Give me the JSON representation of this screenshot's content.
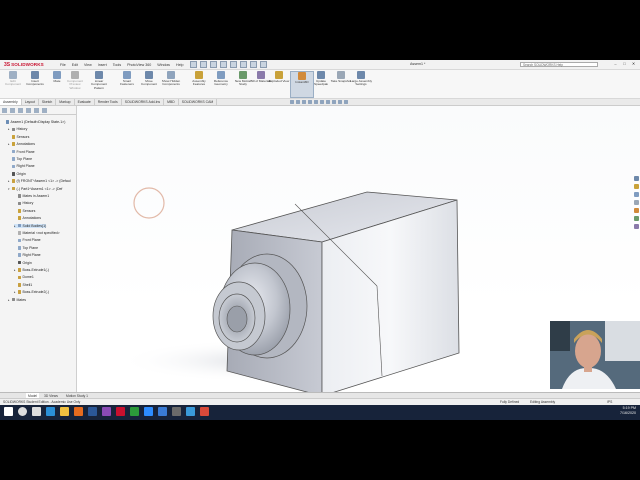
{
  "app": {
    "logo_ds": "3S",
    "logo_name": "SOLIDWORKS",
    "menus": [
      "File",
      "Edit",
      "View",
      "Insert",
      "Tools",
      "PhotoView 360",
      "Window",
      "Help"
    ],
    "document_title": "Assem1 *",
    "search_placeholder": "Search SOLIDWORKS Help"
  },
  "ribbon": {
    "buttons": [
      {
        "label": "Edit Component",
        "dim": true
      },
      {
        "label": "Insert Components"
      },
      {
        "label": "Mate"
      },
      {
        "label": "Component Preview Window",
        "dim": true
      },
      {
        "label": "Linear Component Pattern"
      },
      {
        "label": "Smart Fasteners"
      },
      {
        "label": "Move Component"
      },
      {
        "label": "Show Hidden Components"
      },
      {
        "label": "Assembly Features"
      },
      {
        "label": "Reference Geometry"
      },
      {
        "label": "New Motion Study"
      },
      {
        "label": "Bill of Materials"
      },
      {
        "label": "Exploded View"
      },
      {
        "label": "Instant3D",
        "active": true
      },
      {
        "label": "Update Speedpak"
      },
      {
        "label": "Take Snapshot"
      },
      {
        "label": "Large Assembly Settings"
      }
    ]
  },
  "tabs": [
    "Assembly",
    "Layout",
    "Sketch",
    "Markup",
    "Evaluate",
    "Render Tools",
    "SOLIDWORKS Add-Ins",
    "MBD",
    "SOLIDWORKS CAM"
  ],
  "tree": {
    "nodes": [
      {
        "label": "Assem1  (Default<Display State-1>)",
        "depth": 0,
        "exp": "",
        "color": "#6b8db5"
      },
      {
        "label": "History",
        "depth": 1,
        "exp": "▸",
        "color": "#8a8a8a"
      },
      {
        "label": "Sensors",
        "depth": 1,
        "exp": "",
        "color": "#c9a23a"
      },
      {
        "label": "Annotations",
        "depth": 1,
        "exp": "▸",
        "color": "#c9a23a"
      },
      {
        "label": "Front Plane",
        "depth": 1,
        "exp": "",
        "color": "#8fa8c8"
      },
      {
        "label": "Top Plane",
        "depth": 1,
        "exp": "",
        "color": "#8fa8c8"
      },
      {
        "label": "Right Plane",
        "depth": 1,
        "exp": "",
        "color": "#8fa8c8"
      },
      {
        "label": "Origin",
        "depth": 1,
        "exp": "",
        "color": "#555555"
      },
      {
        "label": "(f) FRONT^Assem1 <1> -> (Defaul",
        "depth": 1,
        "exp": "▸",
        "color": "#c8a040"
      },
      {
        "label": "(-) Part1^Assem1 <1> -> (Def",
        "depth": 1,
        "exp": "▾",
        "color": "#c8a040"
      },
      {
        "label": "Mates in Assem1",
        "depth": 2,
        "exp": "",
        "color": "#8a8a8a"
      },
      {
        "label": "History",
        "depth": 2,
        "exp": "",
        "color": "#8a8a8a"
      },
      {
        "label": "Sensors",
        "depth": 2,
        "exp": "",
        "color": "#c9a23a"
      },
      {
        "label": "Annotations",
        "depth": 2,
        "exp": "",
        "color": "#c9a23a"
      },
      {
        "label": "Solid Bodies(1)",
        "depth": 2,
        "exp": "▸",
        "color": "#7f9cc0",
        "sel": true
      },
      {
        "label": "Material <not specified>",
        "depth": 2,
        "exp": "",
        "color": "#b0b0b0"
      },
      {
        "label": "Front Plane",
        "depth": 2,
        "exp": "",
        "color": "#8fa8c8"
      },
      {
        "label": "Top Plane",
        "depth": 2,
        "exp": "",
        "color": "#8fa8c8"
      },
      {
        "label": "Right Plane",
        "depth": 2,
        "exp": "",
        "color": "#8fa8c8"
      },
      {
        "label": "Origin",
        "depth": 2,
        "exp": "",
        "color": "#555555"
      },
      {
        "label": "Boss-Extrude1(-)",
        "depth": 2,
        "exp": "▸",
        "color": "#c8a040"
      },
      {
        "label": "Dome1",
        "depth": 2,
        "exp": "",
        "color": "#c8a040"
      },
      {
        "label": "Shell1",
        "depth": 2,
        "exp": "",
        "color": "#c8a040"
      },
      {
        "label": "Boss-Extrude2(-)",
        "depth": 2,
        "exp": "▸",
        "color": "#c8a040"
      },
      {
        "label": "Mates",
        "depth": 1,
        "exp": "▸",
        "color": "#8a8a8a"
      }
    ]
  },
  "bottom_tabs": [
    "Model",
    "3D Views",
    "Motion Study 1"
  ],
  "status": {
    "left": "SOLIDWORKS Student Edition - Academic Use Only",
    "defined": "Fully Defined",
    "mode": "Editing Assembly",
    "units": "IPS"
  },
  "taskbar": {
    "icons": [
      {
        "name": "windows-icon",
        "color": "#ffffff"
      },
      {
        "name": "search-icon",
        "color": "#dddddd"
      },
      {
        "name": "task-view-icon",
        "color": "#dddddd"
      },
      {
        "name": "edge-icon",
        "color": "#2b8fd6"
      },
      {
        "name": "file-explorer-icon",
        "color": "#f0c040"
      },
      {
        "name": "firefox-icon",
        "color": "#e66b1e"
      },
      {
        "name": "word-icon",
        "color": "#2b5797"
      },
      {
        "name": "app-icon",
        "color": "#8a4bb5"
      },
      {
        "name": "solidworks-icon",
        "color": "#c8102e"
      },
      {
        "name": "camtasia-icon",
        "color": "#2c9a3a"
      },
      {
        "name": "zoom-icon",
        "color": "#2d8cff"
      },
      {
        "name": "app-icon",
        "color": "#3a7bd5"
      },
      {
        "name": "app-icon",
        "color": "#6a6a6a"
      },
      {
        "name": "app-icon",
        "color": "#3a9ad9"
      },
      {
        "name": "app-icon",
        "color": "#d94a3a"
      }
    ],
    "time": "5:19 PM",
    "date": "7/16/2020"
  },
  "colors": {
    "accent": "#c8102e",
    "taskbar": "#17233a"
  }
}
